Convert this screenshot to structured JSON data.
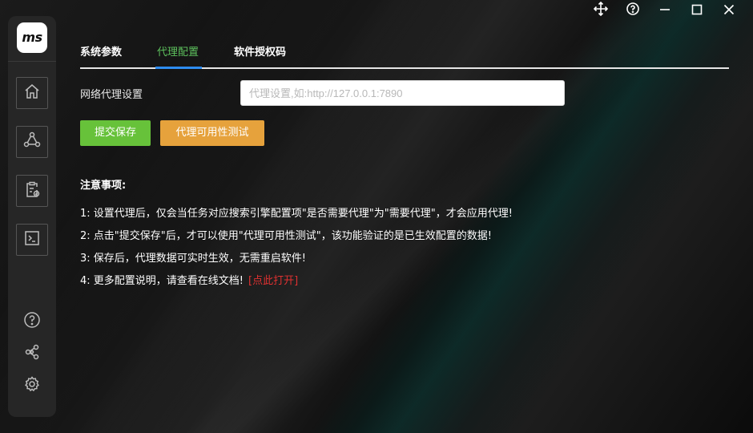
{
  "app": {
    "logo_text": "ms"
  },
  "titlebar": {
    "move_icon": "move-icon",
    "help_icon": "help-icon",
    "minimize_icon": "minimize-icon",
    "maximize_icon": "maximize-icon",
    "close_icon": "close-icon"
  },
  "sidebar": {
    "items": [
      {
        "name": "home",
        "icon": "home-icon"
      },
      {
        "name": "network",
        "icon": "network-nodes-icon"
      },
      {
        "name": "tasks",
        "icon": "clipboard-check-icon"
      },
      {
        "name": "terminal",
        "icon": "terminal-icon"
      }
    ],
    "bottom": [
      {
        "name": "help",
        "icon": "help-circle-icon"
      },
      {
        "name": "plugins",
        "icon": "share-nodes-icon"
      },
      {
        "name": "settings",
        "icon": "gear-icon"
      }
    ]
  },
  "tabs": [
    {
      "label": "系统参数",
      "active": false
    },
    {
      "label": "代理配置",
      "active": true
    },
    {
      "label": "软件授权码",
      "active": false
    }
  ],
  "form": {
    "label": "网络代理设置",
    "placeholder": "代理设置,如:http://127.0.0.1:7890",
    "value": ""
  },
  "buttons": {
    "save": "提交保存",
    "test": "代理可用性测试"
  },
  "colors": {
    "save": "#67c23a",
    "test": "#e6a23c",
    "active_tab": "#5dc05d",
    "link": "#e03131"
  },
  "notes": {
    "title": "注意事项:",
    "items": [
      "1: 设置代理后，仅会当任务对应搜索引擎配置项\"是否需要代理\"为\"需要代理\"，才会应用代理!",
      "2: 点击\"提交保存\"后，才可以使用\"代理可用性测试\"，该功能验证的是已生效配置的数据!",
      "3: 保存后，代理数据可实时生效，无需重启软件!",
      "4: 更多配置说明，请查看在线文档!"
    ],
    "link": "[点此打开]"
  }
}
